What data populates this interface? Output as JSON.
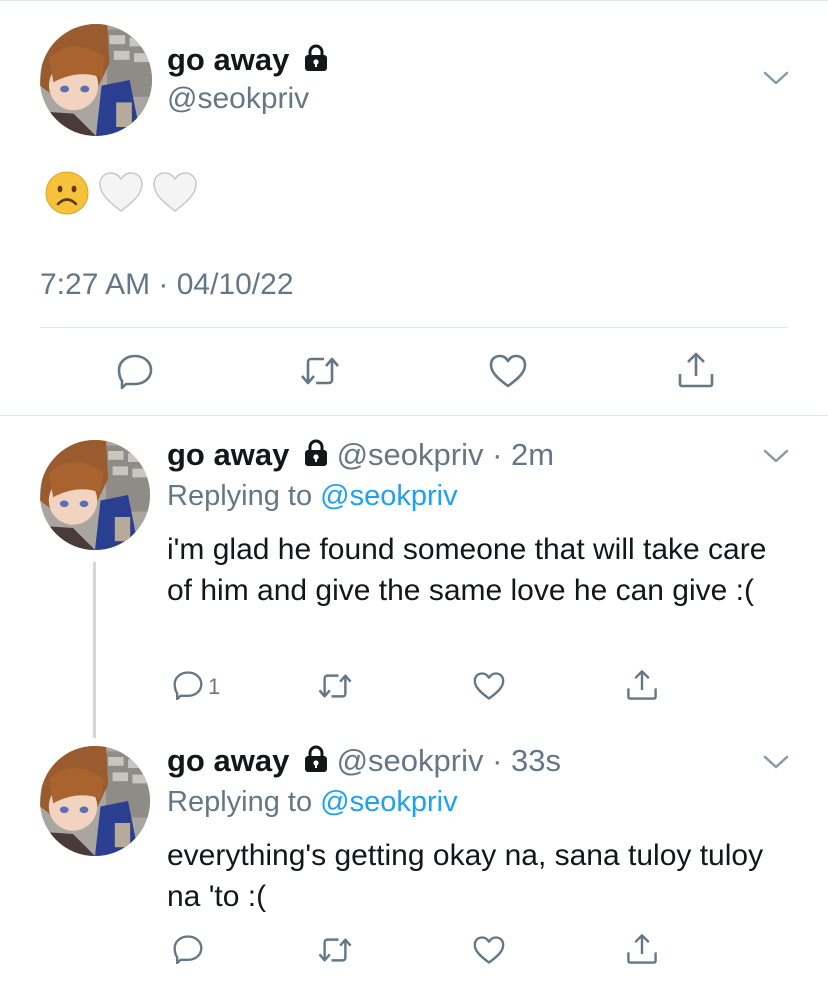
{
  "main_tweet": {
    "display_name": "go away",
    "handle": "@seokpriv",
    "emojis": [
      "frowning-face",
      "white-heart",
      "white-heart"
    ],
    "timestamp": "7:27 AM · 04/10/22",
    "actions": [
      "reply",
      "retweet",
      "like",
      "share"
    ]
  },
  "replies": [
    {
      "display_name": "go away",
      "handle": "@seokpriv",
      "time": "· 2m",
      "replying_label": "Replying to",
      "replying_handle": "@seokpriv",
      "text": "i'm glad he found someone that will take care of him and give the same love he can give :(",
      "reply_count": "1"
    },
    {
      "display_name": "go away",
      "handle": "@seokpriv",
      "time": "· 33s",
      "replying_label": "Replying to",
      "replying_handle": "@seokpriv",
      "text": "everything's getting okay na, sana tuloy tuloy na 'to :(",
      "reply_count": ""
    }
  ],
  "colors": {
    "text": "#14171a",
    "secondary": "#657786",
    "link": "#1da1f2",
    "divider": "#e1e8ed"
  }
}
